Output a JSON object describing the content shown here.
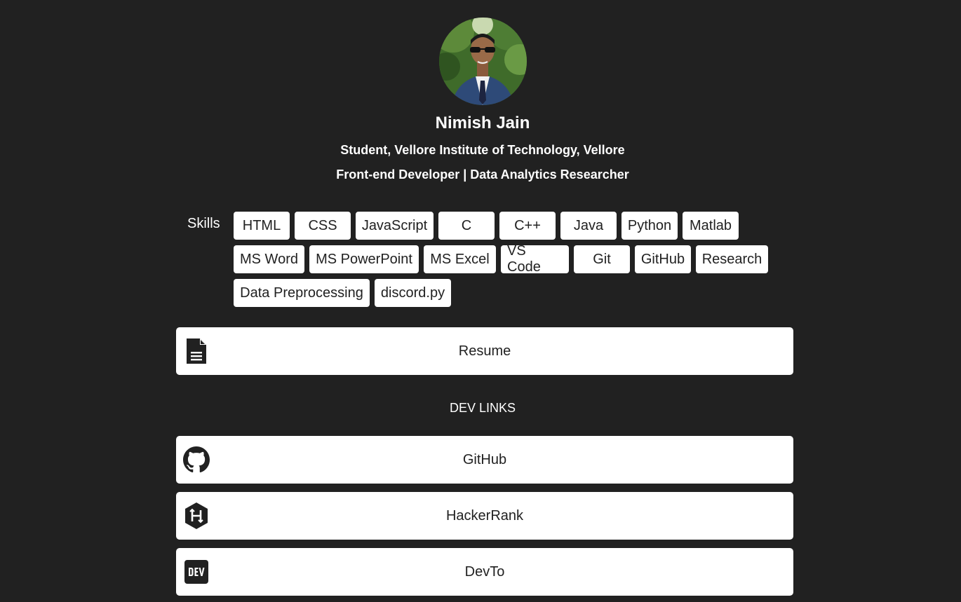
{
  "profile": {
    "name": "Nimish Jain",
    "subtitle_1": "Student, Vellore Institute of Technology, Vellore",
    "subtitle_2": "Front-end Developer | Data Analytics Researcher"
  },
  "skills": {
    "label": "Skills",
    "items": [
      "HTML",
      "CSS",
      "JavaScript",
      "C",
      "C++",
      "Java",
      "Python",
      "Matlab",
      "MS Word",
      "MS PowerPoint",
      "MS Excel",
      "VS Code",
      "Git",
      "GitHub",
      "Research",
      "Data Preprocessing",
      "discord.py"
    ]
  },
  "resume": {
    "label": "Resume",
    "icon": "document-icon"
  },
  "dev_links": {
    "heading": "DEV LINKS",
    "items": [
      {
        "label": "GitHub",
        "icon": "github-icon"
      },
      {
        "label": "HackerRank",
        "icon": "hackerrank-icon"
      },
      {
        "label": "DevTo",
        "icon": "devto-icon"
      }
    ]
  },
  "colors": {
    "background": "#212121",
    "card": "#ffffff",
    "text_dark": "#212121",
    "text_light": "#ffffff"
  }
}
